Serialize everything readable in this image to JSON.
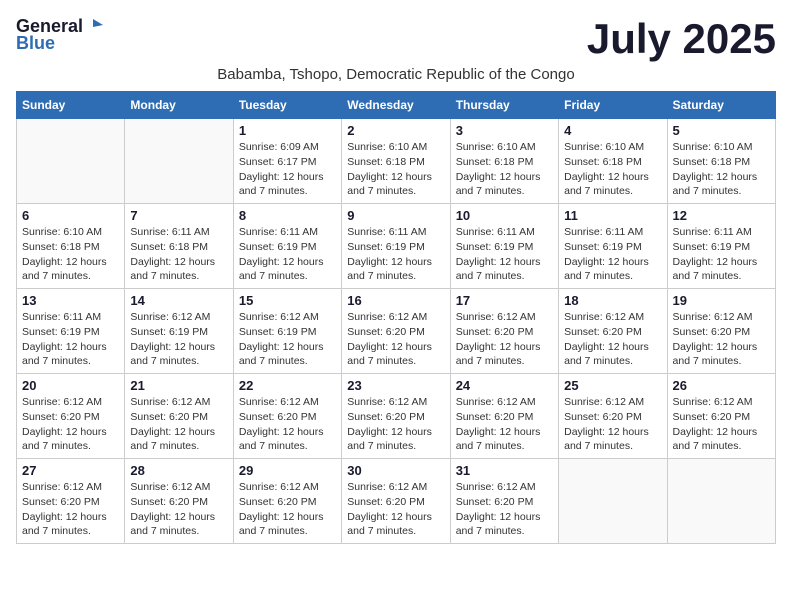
{
  "logo": {
    "general": "General",
    "blue": "Blue"
  },
  "title": {
    "month_year": "July 2025",
    "location": "Babamba, Tshopo, Democratic Republic of the Congo"
  },
  "calendar": {
    "headers": [
      "Sunday",
      "Monday",
      "Tuesday",
      "Wednesday",
      "Thursday",
      "Friday",
      "Saturday"
    ],
    "weeks": [
      [
        {
          "day": "",
          "info": ""
        },
        {
          "day": "",
          "info": ""
        },
        {
          "day": "1",
          "info": "Sunrise: 6:09 AM\nSunset: 6:17 PM\nDaylight: 12 hours and 7 minutes."
        },
        {
          "day": "2",
          "info": "Sunrise: 6:10 AM\nSunset: 6:18 PM\nDaylight: 12 hours and 7 minutes."
        },
        {
          "day": "3",
          "info": "Sunrise: 6:10 AM\nSunset: 6:18 PM\nDaylight: 12 hours and 7 minutes."
        },
        {
          "day": "4",
          "info": "Sunrise: 6:10 AM\nSunset: 6:18 PM\nDaylight: 12 hours and 7 minutes."
        },
        {
          "day": "5",
          "info": "Sunrise: 6:10 AM\nSunset: 6:18 PM\nDaylight: 12 hours and 7 minutes."
        }
      ],
      [
        {
          "day": "6",
          "info": "Sunrise: 6:10 AM\nSunset: 6:18 PM\nDaylight: 12 hours and 7 minutes."
        },
        {
          "day": "7",
          "info": "Sunrise: 6:11 AM\nSunset: 6:18 PM\nDaylight: 12 hours and 7 minutes."
        },
        {
          "day": "8",
          "info": "Sunrise: 6:11 AM\nSunset: 6:19 PM\nDaylight: 12 hours and 7 minutes."
        },
        {
          "day": "9",
          "info": "Sunrise: 6:11 AM\nSunset: 6:19 PM\nDaylight: 12 hours and 7 minutes."
        },
        {
          "day": "10",
          "info": "Sunrise: 6:11 AM\nSunset: 6:19 PM\nDaylight: 12 hours and 7 minutes."
        },
        {
          "day": "11",
          "info": "Sunrise: 6:11 AM\nSunset: 6:19 PM\nDaylight: 12 hours and 7 minutes."
        },
        {
          "day": "12",
          "info": "Sunrise: 6:11 AM\nSunset: 6:19 PM\nDaylight: 12 hours and 7 minutes."
        }
      ],
      [
        {
          "day": "13",
          "info": "Sunrise: 6:11 AM\nSunset: 6:19 PM\nDaylight: 12 hours and 7 minutes."
        },
        {
          "day": "14",
          "info": "Sunrise: 6:12 AM\nSunset: 6:19 PM\nDaylight: 12 hours and 7 minutes."
        },
        {
          "day": "15",
          "info": "Sunrise: 6:12 AM\nSunset: 6:19 PM\nDaylight: 12 hours and 7 minutes."
        },
        {
          "day": "16",
          "info": "Sunrise: 6:12 AM\nSunset: 6:20 PM\nDaylight: 12 hours and 7 minutes."
        },
        {
          "day": "17",
          "info": "Sunrise: 6:12 AM\nSunset: 6:20 PM\nDaylight: 12 hours and 7 minutes."
        },
        {
          "day": "18",
          "info": "Sunrise: 6:12 AM\nSunset: 6:20 PM\nDaylight: 12 hours and 7 minutes."
        },
        {
          "day": "19",
          "info": "Sunrise: 6:12 AM\nSunset: 6:20 PM\nDaylight: 12 hours and 7 minutes."
        }
      ],
      [
        {
          "day": "20",
          "info": "Sunrise: 6:12 AM\nSunset: 6:20 PM\nDaylight: 12 hours and 7 minutes."
        },
        {
          "day": "21",
          "info": "Sunrise: 6:12 AM\nSunset: 6:20 PM\nDaylight: 12 hours and 7 minutes."
        },
        {
          "day": "22",
          "info": "Sunrise: 6:12 AM\nSunset: 6:20 PM\nDaylight: 12 hours and 7 minutes."
        },
        {
          "day": "23",
          "info": "Sunrise: 6:12 AM\nSunset: 6:20 PM\nDaylight: 12 hours and 7 minutes."
        },
        {
          "day": "24",
          "info": "Sunrise: 6:12 AM\nSunset: 6:20 PM\nDaylight: 12 hours and 7 minutes."
        },
        {
          "day": "25",
          "info": "Sunrise: 6:12 AM\nSunset: 6:20 PM\nDaylight: 12 hours and 7 minutes."
        },
        {
          "day": "26",
          "info": "Sunrise: 6:12 AM\nSunset: 6:20 PM\nDaylight: 12 hours and 7 minutes."
        }
      ],
      [
        {
          "day": "27",
          "info": "Sunrise: 6:12 AM\nSunset: 6:20 PM\nDaylight: 12 hours and 7 minutes."
        },
        {
          "day": "28",
          "info": "Sunrise: 6:12 AM\nSunset: 6:20 PM\nDaylight: 12 hours and 7 minutes."
        },
        {
          "day": "29",
          "info": "Sunrise: 6:12 AM\nSunset: 6:20 PM\nDaylight: 12 hours and 7 minutes."
        },
        {
          "day": "30",
          "info": "Sunrise: 6:12 AM\nSunset: 6:20 PM\nDaylight: 12 hours and 7 minutes."
        },
        {
          "day": "31",
          "info": "Sunrise: 6:12 AM\nSunset: 6:20 PM\nDaylight: 12 hours and 7 minutes."
        },
        {
          "day": "",
          "info": ""
        },
        {
          "day": "",
          "info": ""
        }
      ]
    ]
  }
}
